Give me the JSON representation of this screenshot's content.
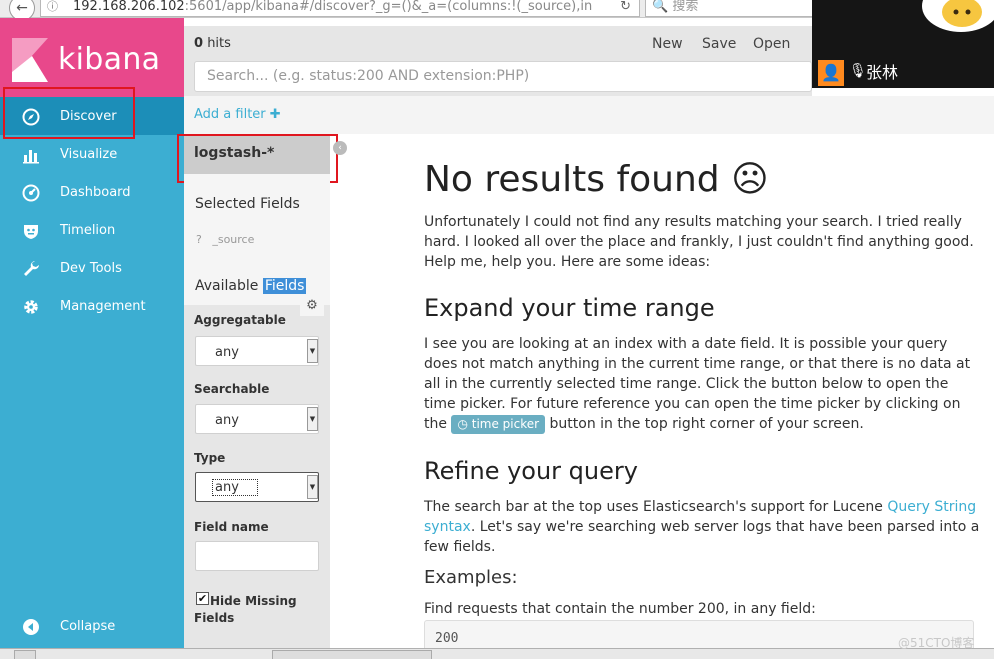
{
  "browser": {
    "url_host": "192.168.206.102",
    "url_rest": ":5601/app/kibana#/discover?_g=()&_a=(columns:!(_source),in",
    "search_placeholder": "搜索",
    "back_icon": "back-arrow-icon",
    "reload_icon": "reload-icon"
  },
  "sidebar": {
    "brand": "kibana",
    "brand_color": "#e8488b",
    "bg_color": "#3caed2",
    "items": [
      {
        "label": "Discover",
        "icon": "compass-icon",
        "active": true
      },
      {
        "label": "Visualize",
        "icon": "bar-chart-icon",
        "active": false
      },
      {
        "label": "Dashboard",
        "icon": "dashboard-gauge-icon",
        "active": false
      },
      {
        "label": "Timelion",
        "icon": "timelion-shield-icon",
        "active": false
      },
      {
        "label": "Dev Tools",
        "icon": "wrench-icon",
        "active": false
      },
      {
        "label": "Management",
        "icon": "gear-icon",
        "active": false
      }
    ],
    "collapse_label": "Collapse"
  },
  "topbar": {
    "hits_count": "0",
    "hits_label": "hits",
    "actions": [
      "New",
      "Save",
      "Open"
    ],
    "query_placeholder": "Search... (e.g. status:200 AND extension:PHP)"
  },
  "filterbar": {
    "add_filter": "Add a filter"
  },
  "fields": {
    "index_pattern": "logstash-*",
    "selected_title": "Selected Fields",
    "source_field_type": "?",
    "source_field": "_source",
    "available_title_1": "Available",
    "available_title_2": "Fields"
  },
  "filters": {
    "aggregatable_label": "Aggregatable",
    "aggregatable_value": "any",
    "searchable_label": "Searchable",
    "searchable_value": "any",
    "type_label": "Type",
    "type_value": "any",
    "field_name_label": "Field name",
    "field_name_value": "",
    "hide_missing_1": "Hide Missing",
    "hide_missing_2": "Fields",
    "hide_missing_checked": true
  },
  "content": {
    "title": "No results found ☹",
    "intro": "Unfortunately I could not find any results matching your search. I tried really hard. I looked all over the place and frankly, I just couldn't find anything good. Help me, help you. Here are some ideas:",
    "expand_title": "Expand your time range",
    "expand_text_1": "I see you are looking at an index with a date field. It is possible your query does not match anything in the current time range, or that there is no data at all in the currently selected time range. Click the button below to open the time picker. For future reference you can open the time picker by clicking on the",
    "time_picker_label": "time picker",
    "expand_text_2": "button in the top right corner of your screen.",
    "refine_title": "Refine your query",
    "refine_text_1": "The search bar at the top uses Elasticsearch's support for Lucene",
    "refine_link": "Query String syntax",
    "refine_text_2": ". Let's say we're searching web server logs that have been parsed into a few fields.",
    "examples_title": "Examples:",
    "example_1_text": "Find requests that contain the number 200, in any field:",
    "example_1_code": "200"
  },
  "overlay": {
    "caller_name": "张林"
  },
  "watermark": "@51CTO博客"
}
